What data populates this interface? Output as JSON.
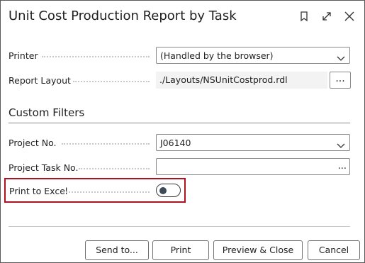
{
  "dialog": {
    "title": "Unit Cost Production Report by Task",
    "icons": [
      "bookmark-icon",
      "expand-icon",
      "close-icon"
    ]
  },
  "fields": {
    "printer": {
      "label": "Printer",
      "value": "(Handled by the browser)"
    },
    "report_layout": {
      "label": "Report Layout",
      "value": "./Layouts/NSUnitCostprod.rdl",
      "button": "..."
    }
  },
  "filters": {
    "section_title": "Custom Filters",
    "project_no": {
      "label": "Project No.",
      "value": "J06140"
    },
    "project_task_no": {
      "label": "Project Task No.",
      "value": "",
      "button": "..."
    },
    "print_to_excel": {
      "label": "Print to Excel",
      "checked": false
    }
  },
  "footer": {
    "send_to": "Send to...",
    "print": "Print",
    "preview_close": "Preview & Close",
    "cancel": "Cancel"
  },
  "colors": {
    "highlight": "#b01020",
    "knob": "#3c4a5a"
  }
}
